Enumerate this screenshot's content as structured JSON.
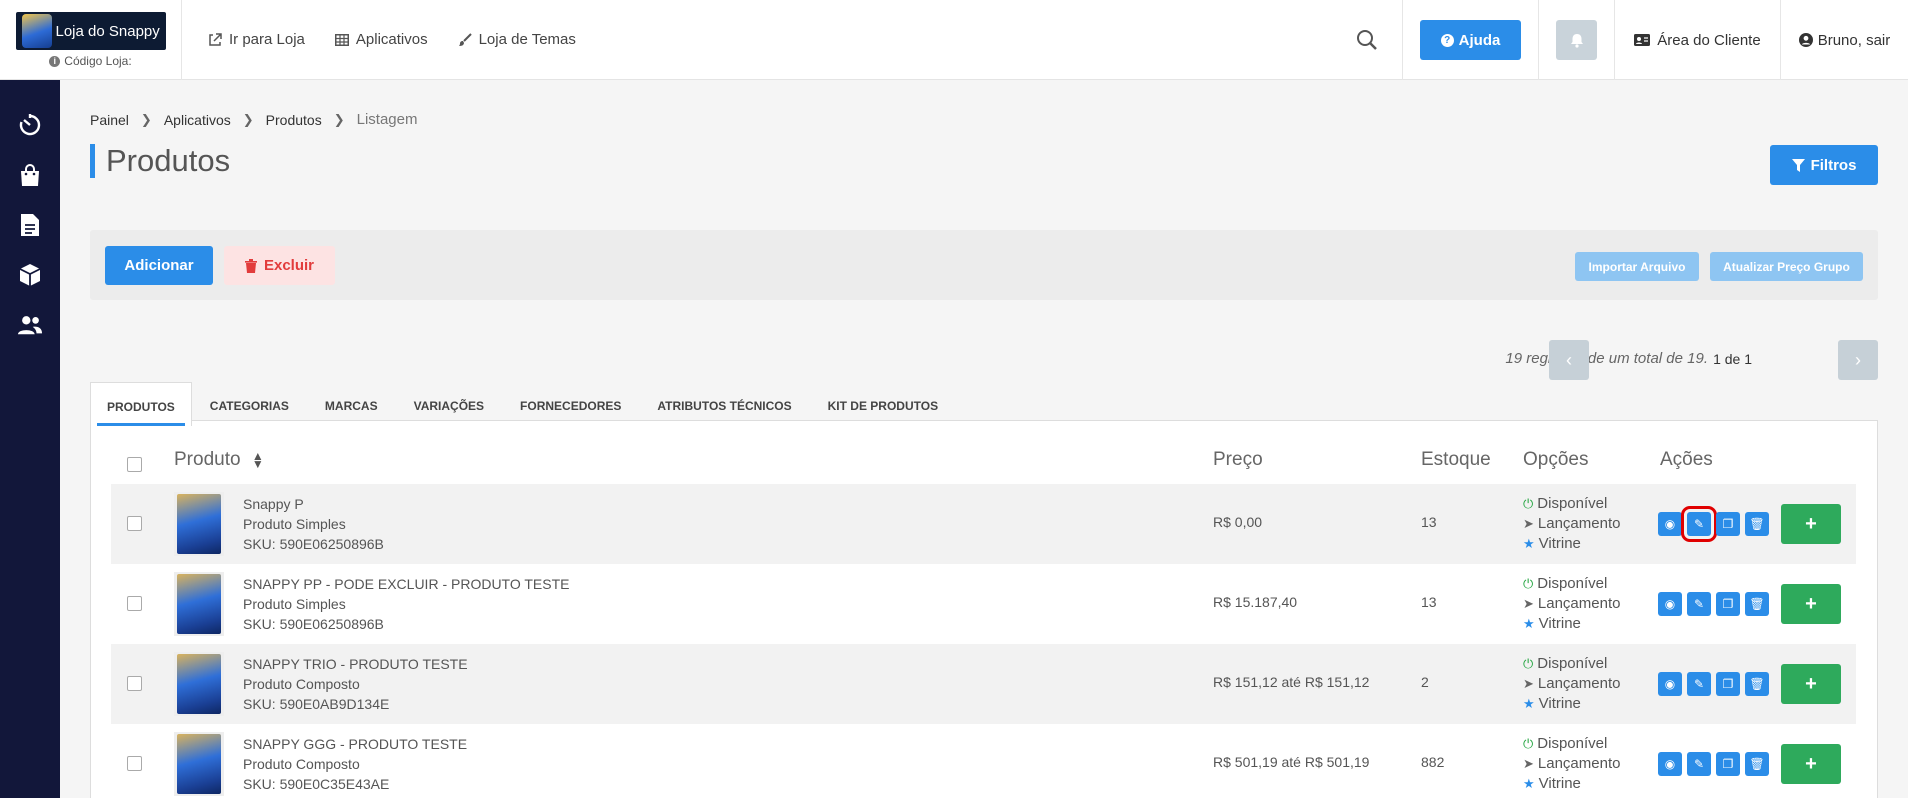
{
  "brand": {
    "logo_text": "Loja do Snappy",
    "store_code_label": "Código Loja:"
  },
  "topnav": {
    "items": [
      {
        "label": "Ir para Loja",
        "icon": "external-link-icon"
      },
      {
        "label": "Aplicativos",
        "icon": "grid-icon"
      },
      {
        "label": "Loja de Temas",
        "icon": "brush-icon"
      }
    ]
  },
  "header": {
    "help_label": "Ajuda",
    "client_area_label": "Área do Cliente",
    "user_label": "Bruno, sair"
  },
  "breadcrumb": {
    "items": [
      "Painel",
      "Aplicativos",
      "Produtos"
    ],
    "current": "Listagem"
  },
  "page": {
    "title": "Produtos",
    "filters_label": "Filtros"
  },
  "toolbar": {
    "add_label": "Adicionar",
    "delete_label": "Excluir",
    "import_label": "Importar Arquivo",
    "update_price_label": "Atualizar Preço Grupo"
  },
  "pagination": {
    "records_text": "19 registros de um total de 19.",
    "page_text": "1 de 1"
  },
  "tabs": [
    {
      "label": "PRODUTOS",
      "active": true
    },
    {
      "label": "CATEGORIAS",
      "active": false
    },
    {
      "label": "MARCAS",
      "active": false
    },
    {
      "label": "VARIAÇÕES",
      "active": false
    },
    {
      "label": "FORNECEDORES",
      "active": false
    },
    {
      "label": "ATRIBUTOS TÉCNICOS",
      "active": false
    },
    {
      "label": "KIT DE PRODUTOS",
      "active": false
    }
  ],
  "table": {
    "headers": {
      "product": "Produto",
      "price": "Preço",
      "stock": "Estoque",
      "options": "Opções",
      "actions": "Ações"
    },
    "option_labels": {
      "available": "Disponível",
      "launch": "Lançamento",
      "showcase": "Vitrine"
    },
    "rows": [
      {
        "name": "Snappy P",
        "type": "Produto Simples",
        "sku": "SKU: 590E06250896B",
        "price": "R$ 0,00",
        "stock": "13"
      },
      {
        "name": "SNAPPY PP - PODE EXCLUIR - PRODUTO TESTE",
        "type": "Produto Simples",
        "sku": "SKU: 590E06250896B",
        "price": "R$ 15.187,40",
        "stock": "13"
      },
      {
        "name": "SNAPPY TRIO - PRODUTO TESTE",
        "type": "Produto Composto",
        "sku": "SKU: 590E0AB9D134E",
        "price": "R$ 151,12 até R$ 151,12",
        "stock": "2"
      },
      {
        "name": "SNAPPY GGG - PRODUTO TESTE",
        "type": "Produto Composto",
        "sku": "SKU: 590E0C35E43AE",
        "price": "R$ 501,19 até R$ 501,19",
        "stock": "882"
      }
    ]
  },
  "colors": {
    "primary": "#2b8de8",
    "sidebar": "#12173a",
    "success": "#2eaa5c",
    "danger": "#e23c3c",
    "highlight": "#e00000"
  }
}
